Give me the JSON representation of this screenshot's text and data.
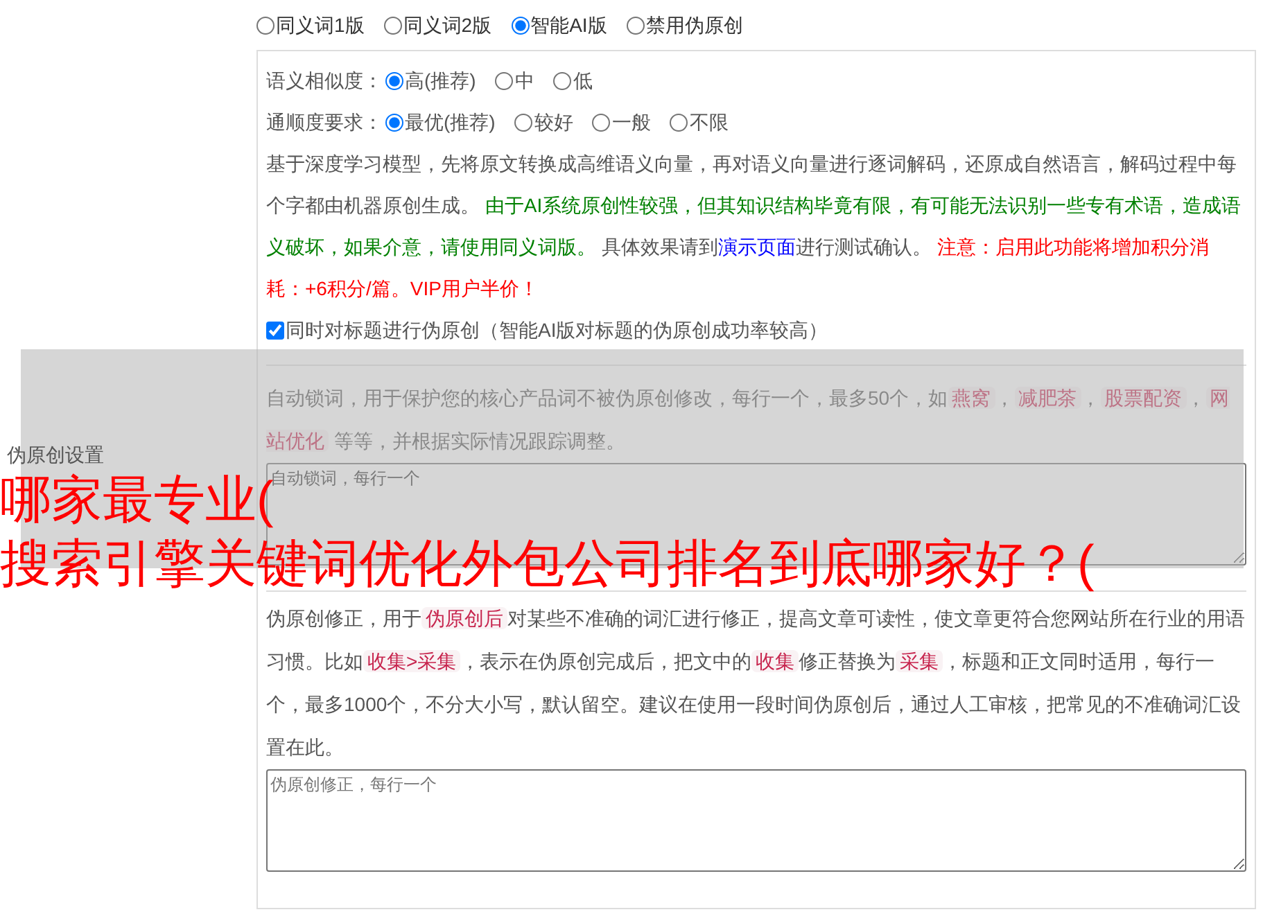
{
  "versions": [
    {
      "label": "同义词1版",
      "selected": false
    },
    {
      "label": "同义词2版",
      "selected": false
    },
    {
      "label": "智能AI版",
      "selected": true
    },
    {
      "label": "禁用伪原创",
      "selected": false
    }
  ],
  "similarity": {
    "label": "语义相似度：",
    "options": [
      {
        "label": "高(推荐)",
        "selected": true
      },
      {
        "label": "中",
        "selected": false
      },
      {
        "label": "低",
        "selected": false
      }
    ]
  },
  "fluency": {
    "label": "通顺度要求：",
    "options": [
      {
        "label": "最优(推荐)",
        "selected": true
      },
      {
        "label": "较好",
        "selected": false
      },
      {
        "label": "一般",
        "selected": false
      },
      {
        "label": "不限",
        "selected": false
      }
    ]
  },
  "description": [
    {
      "kind": "plain",
      "text": "基于深度学习模型，先将原文转换成高维语义向量，再对语义向量进行逐词解码，还原成自然语言，解码过程中每个字都由机器原创生成。 "
    },
    {
      "kind": "caution",
      "text": "由于AI系统原创性较强，但其知识结构毕竟有限，有可能无法识别一些专有术语，造成语义破坏，如果介意，请使用同义词版。"
    },
    {
      "kind": "plain",
      "text": " 具体效果请到"
    },
    {
      "kind": "link",
      "text": "演示页面"
    },
    {
      "kind": "plain",
      "text": "进行测试确认。 "
    },
    {
      "kind": "warning",
      "text": "注意：启用此功能将增加积分消耗：+6积分/篇。VIP用户半价！"
    }
  ],
  "title_option": {
    "label": "同时对标题进行伪原创（智能AI版对标题的伪原创成功率较高）",
    "checked": true
  },
  "lock_words": {
    "segments": [
      {
        "kind": "plain",
        "text": "自动锁词，用于保护您的核心产品词不被伪原创修改，每行一个，最多50个，如"
      },
      {
        "kind": "tag",
        "text": "燕窝"
      },
      {
        "kind": "plain",
        "text": "，"
      },
      {
        "kind": "tag",
        "text": "减肥茶"
      },
      {
        "kind": "plain",
        "text": "，"
      },
      {
        "kind": "tag",
        "text": "股票配资"
      },
      {
        "kind": "plain",
        "text": "，"
      },
      {
        "kind": "tag",
        "text": "网站优化"
      },
      {
        "kind": "plain",
        "text": " 等等，并根据实际情况跟踪调整。"
      }
    ],
    "placeholder": "自动锁词，每行一个"
  },
  "correction": {
    "segments": [
      {
        "kind": "plain",
        "text": "伪原创修正，用于"
      },
      {
        "kind": "tag",
        "text": "伪原创后"
      },
      {
        "kind": "plain",
        "text": "对某些不准确的词汇进行修正，提高文章可读性，使文章更符合您网站所在行业的用语习惯。比如"
      },
      {
        "kind": "tag",
        "text": "收集>采集"
      },
      {
        "kind": "plain",
        "text": "，表示在伪原创完成后，把文中的"
      },
      {
        "kind": "tag",
        "text": "收集"
      },
      {
        "kind": "plain",
        "text": "修正替换为"
      },
      {
        "kind": "tag",
        "text": "采集"
      },
      {
        "kind": "plain",
        "text": "，标题和正文同时适用，每行一个，最多1000个，不分大小写，默认留空。建议在使用一段时间伪原创后，通过人工审核，把常见的不准确词汇设置在此。"
      }
    ],
    "placeholder": "伪原创修正，每行一个"
  },
  "overlay": {
    "label": "伪原创设置",
    "headline": [
      "哪家最专业(",
      "搜索引擎关键词优化外包公司排名到底哪家好？("
    ]
  }
}
